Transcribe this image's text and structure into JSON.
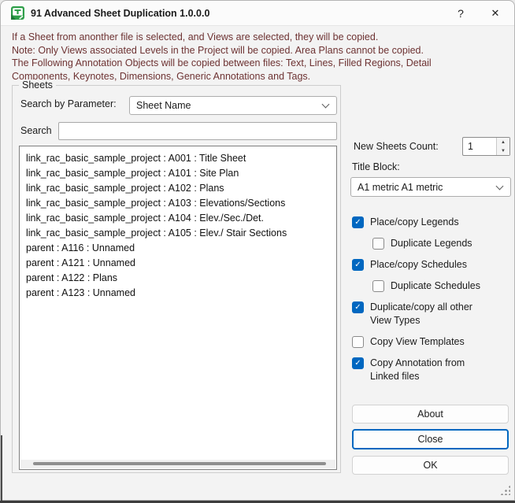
{
  "window": {
    "title": "91 Advanced Sheet Duplication 1.0.0.0",
    "help_glyph": "?",
    "close_glyph": "✕"
  },
  "instructions": {
    "line1": "If a Sheet from anonther file is selected, and Views are selected, they will be copied.",
    "line2": "Note: Only Views associated Levels in the Project will be copied. Area Plans cannot be copied.",
    "line3": "The Following Annotation Objects will be copied between files: Text, Lines, Filled Regions, Detail",
    "line4": "Components, Keynotes, Dimensions, Generic Annotations and Tags."
  },
  "sheets_group": {
    "legend": "Sheets",
    "search_by_parameter_label": "Search by Parameter:",
    "parameter_value": "Sheet Name",
    "search_label": "Search",
    "search_value": "",
    "items": [
      "link_rac_basic_sample_project : A001 : Title Sheet",
      "link_rac_basic_sample_project : A101 : Site Plan",
      "link_rac_basic_sample_project : A102 : Plans",
      "link_rac_basic_sample_project : A103 : Elevations/Sections",
      "link_rac_basic_sample_project : A104 : Elev./Sec./Det.",
      "link_rac_basic_sample_project : A105 : Elev./ Stair Sections",
      "parent : A116 : Unnamed",
      "parent : A121 : Unnamed",
      "parent : A122 : Plans",
      "parent : A123 : Unnamed"
    ]
  },
  "options": {
    "new_sheets_count_label": "New Sheets Count:",
    "new_sheets_count_value": "1",
    "title_block_label": "Title Block:",
    "title_block_value": "A1 metric A1 metric",
    "checkboxes": [
      {
        "label": "Place/copy Legends",
        "checked": true,
        "indent": false
      },
      {
        "label": "Duplicate Legends",
        "checked": false,
        "indent": true
      },
      {
        "label": "Place/copy Schedules",
        "checked": true,
        "indent": false
      },
      {
        "label": "Duplicate Schedules",
        "checked": false,
        "indent": true
      },
      {
        "label": "Duplicate/copy all other View Types",
        "checked": true,
        "indent": false
      },
      {
        "label": "Copy View Templates",
        "checked": false,
        "indent": false
      },
      {
        "label": "Copy Annotation from Linked files",
        "checked": true,
        "indent": false
      }
    ]
  },
  "buttons": {
    "about": "About",
    "close": "Close",
    "ok": "OK"
  },
  "colors": {
    "accent": "#0067c0",
    "instruction_text": "#6d3232",
    "check_glyph": "✓"
  }
}
